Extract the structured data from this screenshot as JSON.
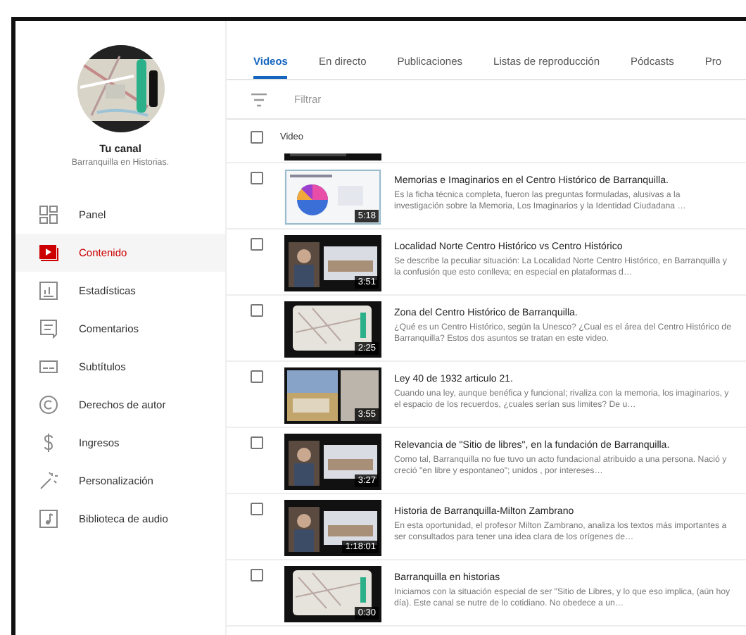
{
  "sidebar": {
    "channel_title": "Tu canal",
    "channel_name": "Barranquilla en Historias.",
    "items": [
      {
        "label": "Panel",
        "selected": false
      },
      {
        "label": "Contenido",
        "selected": true
      },
      {
        "label": "Estadísticas",
        "selected": false
      },
      {
        "label": "Comentarios",
        "selected": false
      },
      {
        "label": "Subtítulos",
        "selected": false
      },
      {
        "label": "Derechos de autor",
        "selected": false
      },
      {
        "label": "Ingresos",
        "selected": false
      },
      {
        "label": "Personalización",
        "selected": false
      },
      {
        "label": "Biblioteca de audio",
        "selected": false
      }
    ]
  },
  "tabs": [
    {
      "label": "Videos",
      "selected": true
    },
    {
      "label": "En directo",
      "selected": false
    },
    {
      "label": "Publicaciones",
      "selected": false
    },
    {
      "label": "Listas de reproducción",
      "selected": false
    },
    {
      "label": "Pódcasts",
      "selected": false
    },
    {
      "label": "Pro",
      "selected": false
    }
  ],
  "filter": {
    "placeholder": "Filtrar"
  },
  "table": {
    "header": {
      "label": "Video",
      "checked": false
    },
    "rows": [
      {
        "title": "Memorias e Imaginarios en el Centro Histórico de Barranquilla.",
        "description": "Es la ficha técnica completa, fueron las preguntas formuladas, alusivas a la investigación sobre la Memoria, Los Imaginarios y la Identidad Ciudadana …",
        "duration": "5:18",
        "checked": false
      },
      {
        "title": "Localidad Norte Centro Histórico vs Centro Histórico",
        "description": "Se describe la peculiar situación: La Localidad Norte Centro Histórico, en Barranquilla y la confusión que esto conlleva; en especial en plataformas d…",
        "duration": "3:51",
        "checked": false
      },
      {
        "title": "Zona del Centro Histórico de Barranquilla.",
        "description": "¿Qué es un Centro Histórico, según la Unesco? ¿Cual es el área del Centro Histórico de Barranquilla? Estos dos asuntos se tratan en este video.",
        "duration": "2:25",
        "checked": false
      },
      {
        "title": "Ley 40 de 1932 articulo 21.",
        "description": "Cuando una ley, aunque benéfica y funcional; rivaliza con la memoria, los imaginarios, y el espacio de los recuerdos, ¿cuales serían sus limites? De u…",
        "duration": "3:55",
        "checked": false
      },
      {
        "title": "Relevancia de \"Sitio de libres\", en la fundación de Barranquilla.",
        "description": "Como tal, Barranquilla no fue tuvo un acto fundacional atribuido a una persona. Nació y creció \"en libre y espontaneo\"; unidos , por intereses…",
        "duration": "3:27",
        "checked": false
      },
      {
        "title": "Historia de Barranquilla-Milton Zambrano",
        "description": "En esta oportunidad, el profesor Milton Zambrano, analiza los textos más importantes a ser consultados para tener una idea clara de los orígenes de…",
        "duration": "1:18:01",
        "checked": false
      },
      {
        "title": "Barranquilla en historias",
        "description": "Iniciamos con la situación especial de ser \"Sitio de Libres, y lo que eso implica, (aún hoy día). Este canal se nutre de lo cotidiano. No obedece a un…",
        "duration": "0:30",
        "checked": false
      }
    ]
  }
}
